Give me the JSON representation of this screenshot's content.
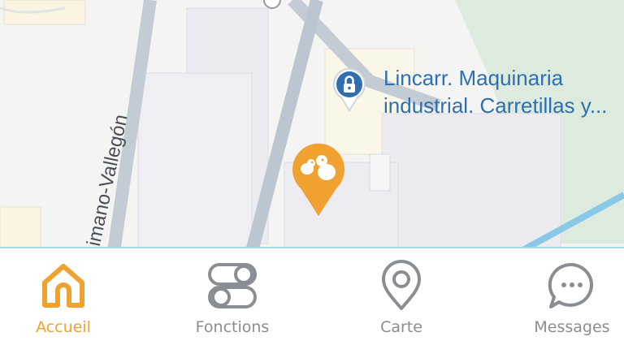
{
  "map": {
    "street_name": "imano-Vallegón",
    "poi": {
      "name_line1": "Lincarr. Maquinaria",
      "name_line2": "industrial. Carretillas y...",
      "icon": "lock-icon",
      "color": "#2f6fb0"
    },
    "marker": {
      "icon": "birds-icon",
      "color": "#f0a130"
    }
  },
  "tabbar": {
    "accent_color": "#f0a130",
    "tabs": [
      {
        "label": "Accueil",
        "icon": "home-icon",
        "active": true
      },
      {
        "label": "Fonctions",
        "icon": "toggles-icon",
        "active": false
      },
      {
        "label": "Carte",
        "icon": "location-pin-icon",
        "active": false
      },
      {
        "label": "Messages",
        "icon": "chat-bubble-icon",
        "active": false
      }
    ]
  }
}
